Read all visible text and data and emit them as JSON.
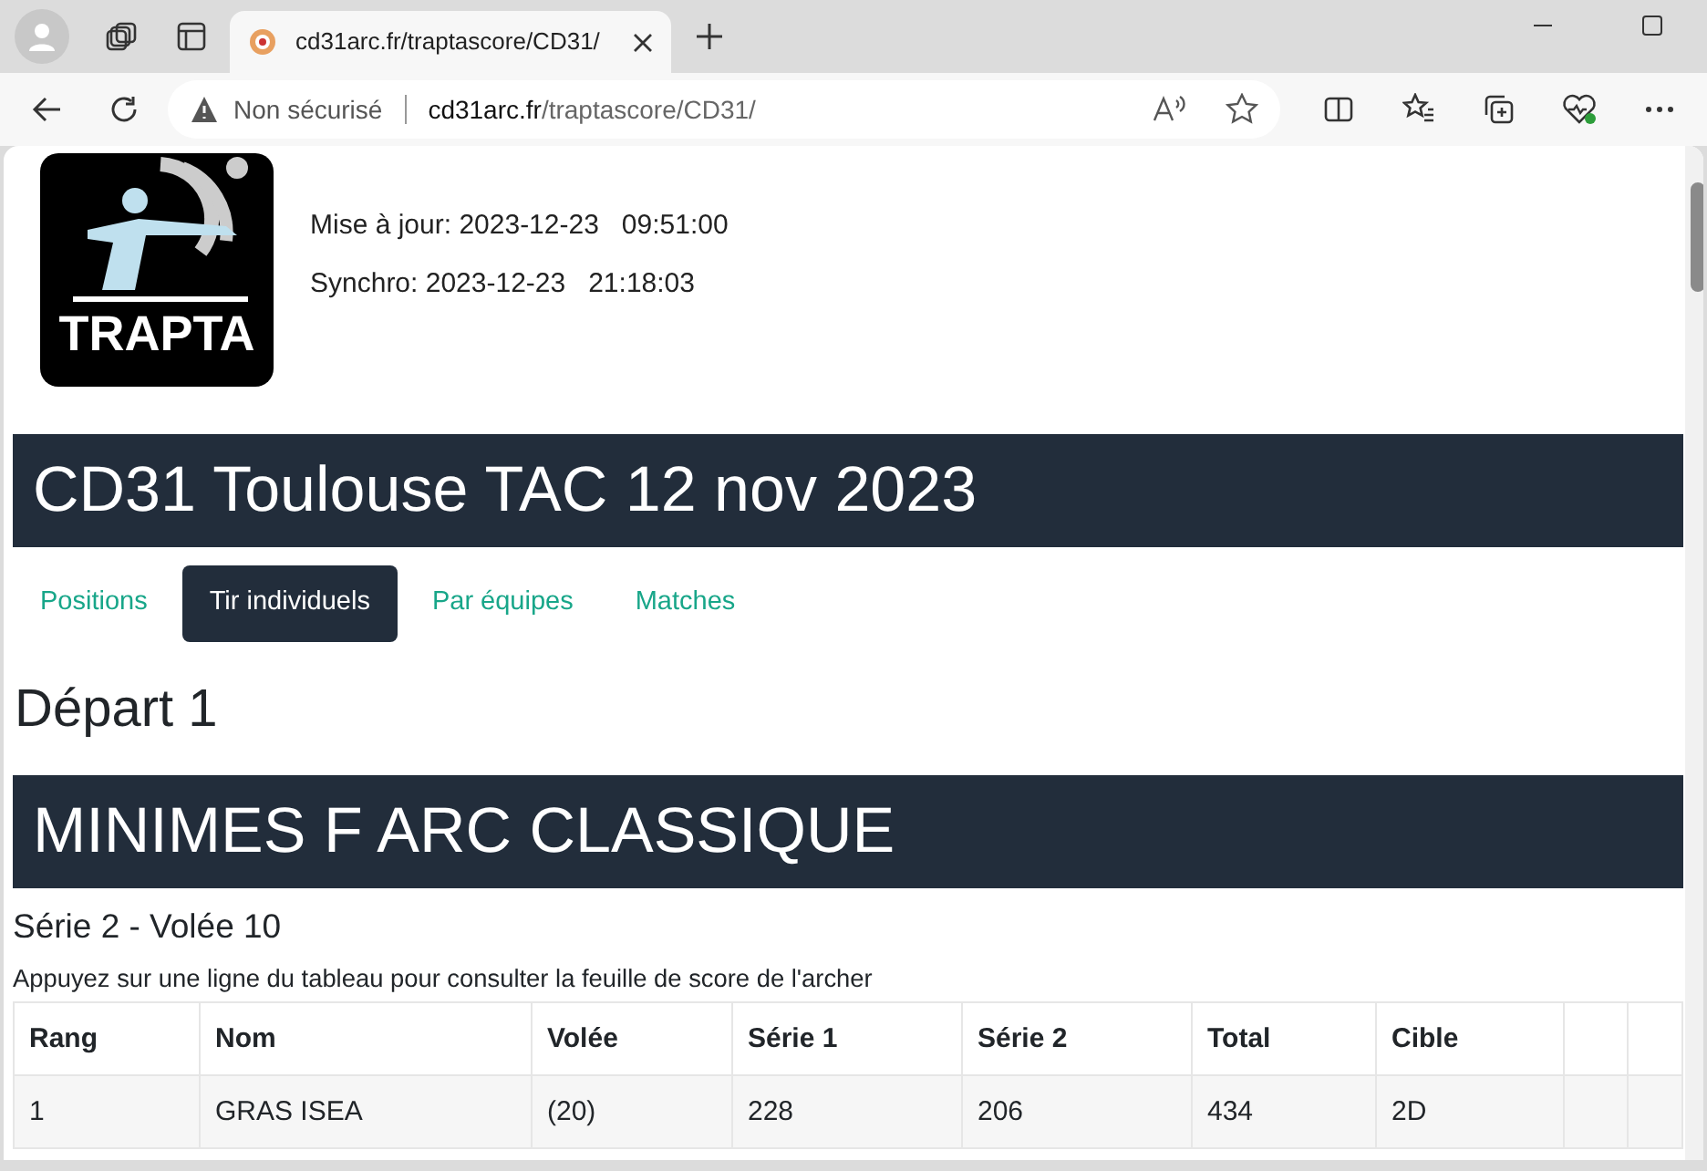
{
  "browser": {
    "tabs": [
      {
        "title": "cd31arc.fr/traptascore/CD31/",
        "selected": true
      }
    ],
    "address": {
      "security": "Non sécurisé",
      "host": "cd31arc.fr",
      "path": "/traptascore/CD31/"
    }
  },
  "page": {
    "logo": {
      "text": "TRAPTA"
    },
    "updates": [
      "Mise à jour: 2023-12-23   09:51:00",
      "Synchro: 2023-12-23   21:18:03"
    ],
    "title": "CD31 Toulouse TAC 12 nov 2023",
    "nav": [
      {
        "label": "Positions",
        "selected": false
      },
      {
        "label": "Tir individuels",
        "selected": true
      },
      {
        "label": "Par équipes",
        "selected": false
      },
      {
        "label": "Matches",
        "selected": false
      }
    ],
    "depart": "Départ 1",
    "category": "MINIMES F ARC CLASSIQUE",
    "serie": "Série 2 - Volée 10",
    "hint": "Appuyez sur une ligne du tableau pour consulter la feuille de score de l'archer",
    "table": {
      "columns": [
        "Rang",
        "Nom",
        "Volée",
        "Série 1",
        "Série 2",
        "Total",
        "Cible"
      ],
      "rows": [
        [
          "1",
          "GRAS ISEA",
          "(20)",
          "228",
          "206",
          "434",
          "2D"
        ]
      ]
    }
  }
}
